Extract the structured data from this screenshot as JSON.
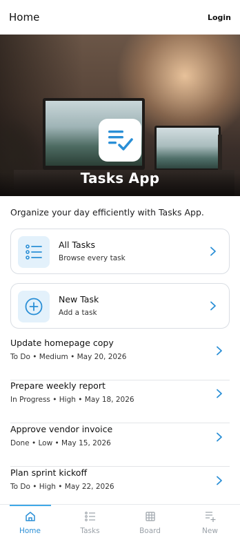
{
  "header": {
    "title": "Home",
    "login_label": "Login"
  },
  "hero": {
    "app_name": "Tasks App",
    "icon": "checklist-icon"
  },
  "intro": "Organize your day efficiently with Tasks App.",
  "cards": [
    {
      "title": "All Tasks",
      "subtitle": "Browse every task",
      "icon": "list-icon"
    },
    {
      "title": "New Task",
      "subtitle": "Add a task",
      "icon": "plus-circle-icon"
    }
  ],
  "tasks": [
    {
      "title": "Update homepage copy",
      "meta": "To Do • Medium • May 20, 2026"
    },
    {
      "title": "Prepare weekly report",
      "meta": "In Progress • High • May 18, 2026"
    },
    {
      "title": "Approve vendor invoice",
      "meta": "Done • Low • May 15, 2026"
    },
    {
      "title": "Plan sprint kickoff",
      "meta": "To Do • High • May 22, 2026"
    }
  ],
  "tabs": [
    {
      "label": "Home",
      "icon": "home-icon",
      "active": true
    },
    {
      "label": "Tasks",
      "icon": "list-icon",
      "active": false
    },
    {
      "label": "Board",
      "icon": "grid-icon",
      "active": false
    },
    {
      "label": "New",
      "icon": "add-list-icon",
      "active": false
    }
  ],
  "colors": {
    "accent": "#2a8fd6",
    "icon_bg": "#e3f1fb",
    "muted": "#9aa1a8"
  }
}
